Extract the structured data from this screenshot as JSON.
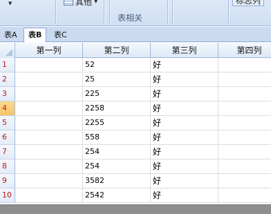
{
  "ribbon": {
    "other_label": "其他",
    "group_label": "表相关",
    "right_label": "标志列"
  },
  "tabs": [
    {
      "label": "表A",
      "active": false
    },
    {
      "label": "表B",
      "active": true
    },
    {
      "label": "表C",
      "active": false
    }
  ],
  "columns": [
    "第一列",
    "第二列",
    "第三列",
    "第四列"
  ],
  "rows": [
    {
      "num": "1",
      "c1": "",
      "c2": "52",
      "c3": "好",
      "c4": ""
    },
    {
      "num": "2",
      "c1": "",
      "c2": "25",
      "c3": "好",
      "c4": ""
    },
    {
      "num": "3",
      "c1": "",
      "c2": "225",
      "c3": "好",
      "c4": ""
    },
    {
      "num": "4",
      "c1": "",
      "c2": "2258",
      "c3": "好",
      "c4": ""
    },
    {
      "num": "5",
      "c1": "",
      "c2": "2255",
      "c3": "好",
      "c4": ""
    },
    {
      "num": "6",
      "c1": "",
      "c2": "558",
      "c3": "好",
      "c4": ""
    },
    {
      "num": "7",
      "c1": "",
      "c2": "254",
      "c3": "好",
      "c4": ""
    },
    {
      "num": "8",
      "c1": "",
      "c2": "254",
      "c3": "好",
      "c4": ""
    },
    {
      "num": "9",
      "c1": "",
      "c2": "3582",
      "c3": "好",
      "c4": ""
    },
    {
      "num": "10",
      "c1": "",
      "c2": "2542",
      "c3": "好",
      "c4": ""
    }
  ],
  "selected_row": "4"
}
